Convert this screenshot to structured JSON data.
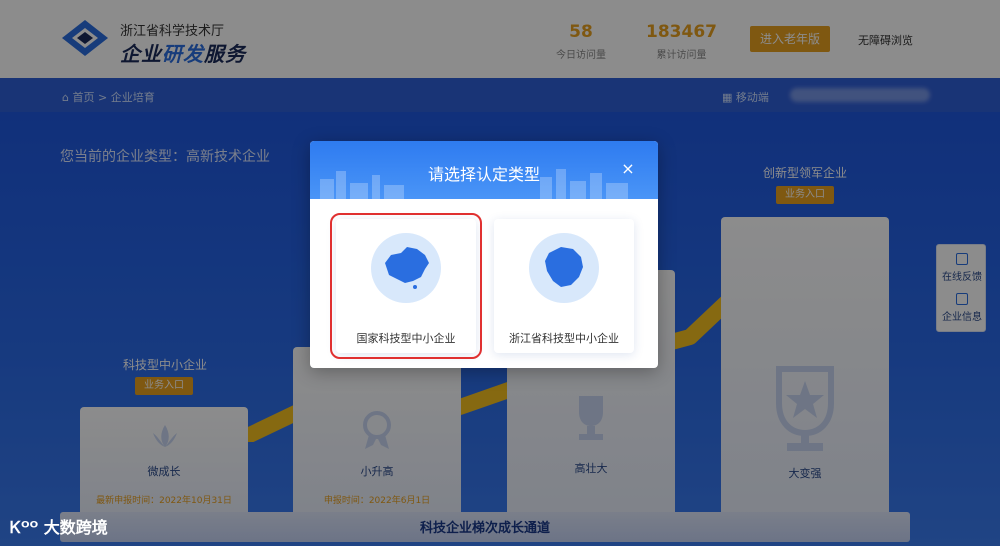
{
  "header": {
    "org_name": "浙江省科学技术厅",
    "app_title_prefix": "企业",
    "app_title_accent": "研发",
    "app_title_suffix": "服务",
    "today_visits": "58",
    "today_visits_label": "今日访问量",
    "total_visits": "183467",
    "total_visits_label": "累计访问量",
    "elder_mode_label": "进入老年版",
    "accessibility_label": "无障碍浏览"
  },
  "breadcrumb": {
    "home": "首页",
    "separator": ">",
    "current": "企业培育",
    "mobile_label": "移动端"
  },
  "main": {
    "enterprise_type_text": "您当前的企业类型：高新技术企业",
    "channel_title": "科技企业梯次成长通道",
    "pedestals": [
      {
        "title": "科技型中小企业",
        "button": "业务入口",
        "name": "微成长",
        "date": "最新申报时间：2022年10月31日",
        "icon": "lotus-icon"
      },
      {
        "title": "",
        "button": "",
        "name": "小升高",
        "date": "申报时间：2022年6月1日",
        "icon": "medal-icon"
      },
      {
        "title": "",
        "button": "",
        "name": "高壮大",
        "date": "",
        "icon": "trophy-icon"
      },
      {
        "title": "创新型领军企业",
        "button": "业务入口",
        "name": "大变强",
        "date": "",
        "icon": "star-trophy-icon"
      }
    ],
    "side_float": [
      {
        "label": "在线反馈",
        "icon": "feedback-icon"
      },
      {
        "label": "企业信息",
        "icon": "info-icon"
      }
    ]
  },
  "modal": {
    "title": "请选择认定类型",
    "close_glyph": "×",
    "options": [
      {
        "label": "国家科技型中小企业",
        "icon": "china-map-icon",
        "selected": true
      },
      {
        "label": "浙江省科技型中小企业",
        "icon": "zhejiang-map-icon",
        "selected": false
      }
    ]
  },
  "watermark": "大数跨境",
  "colors": {
    "accent": "#e8a020",
    "primary": "#2a6ee0",
    "selection_outline": "#e03030"
  }
}
